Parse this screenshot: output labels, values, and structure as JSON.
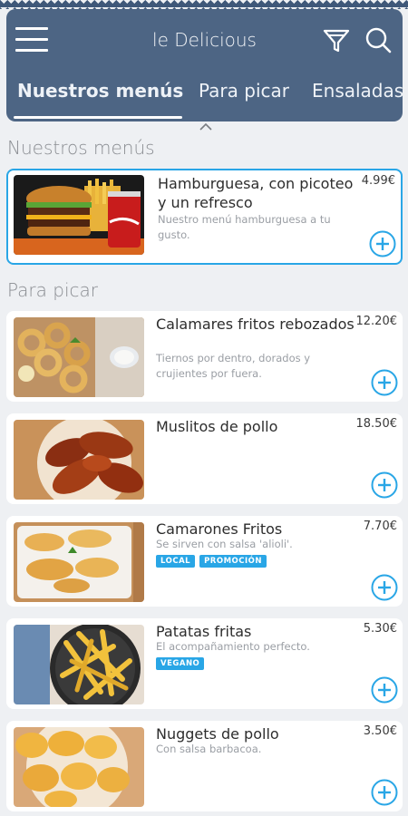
{
  "header": {
    "title": "le Delicious",
    "icons": [
      "menu-icon",
      "filter-icon",
      "search-icon"
    ],
    "tabs": [
      {
        "label": "Nuestros menús",
        "active": true
      },
      {
        "label": "Para picar",
        "active": false
      },
      {
        "label": "Ensaladas",
        "active": false
      }
    ]
  },
  "colors": {
    "header": "#4d6584",
    "accent": "#29a6e6",
    "background": "#eef0f3"
  },
  "sections": [
    {
      "title": "Nuestros menús",
      "items": [
        {
          "name": "Hamburguesa, con picoteo y un refresco",
          "price": "4.99€",
          "description": "Nuestro menú hamburguesa a tu gusto.",
          "tags": [],
          "selected": true
        }
      ]
    },
    {
      "title": "Para picar",
      "items": [
        {
          "name": "Calamares fritos rebozados",
          "price": "12.20€",
          "description": "Tiernos por dentro, dorados y crujientes por fuera.",
          "tags": []
        },
        {
          "name": "Muslitos de pollo",
          "price": "18.50€",
          "description": "",
          "tags": []
        },
        {
          "name": "Camarones Fritos",
          "price": "7.70€",
          "description": "Se sirven con salsa 'alioli'.",
          "tags": [
            "LOCAL",
            "PROMOCIÓN"
          ]
        },
        {
          "name": "Patatas fritas",
          "price": "5.30€",
          "description": "El acompañamiento perfecto.",
          "tags": [
            "VEGANO"
          ]
        },
        {
          "name": "Nuggets de pollo",
          "price": "3.50€",
          "description": "Con salsa barbacoa.",
          "tags": []
        }
      ]
    }
  ]
}
